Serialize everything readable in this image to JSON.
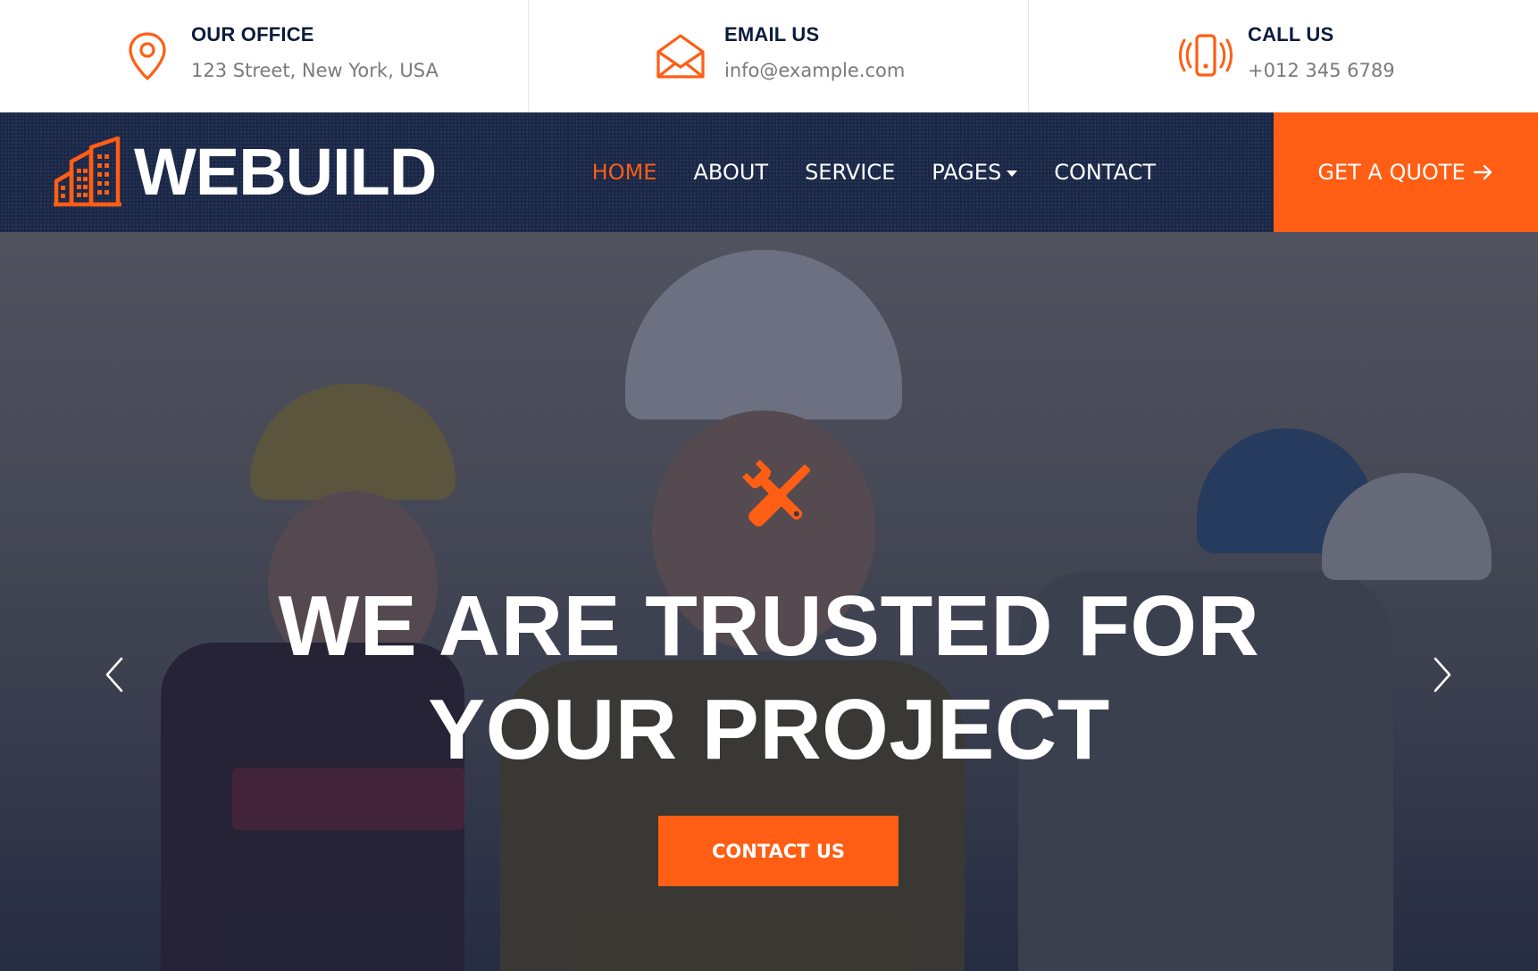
{
  "colors": {
    "accent": "#ff5e14",
    "navy": "#1a2747",
    "heading": "#0b1b3d",
    "muted": "#7a7a7a"
  },
  "topbar": {
    "office": {
      "icon": "map-pin-icon",
      "title": "OUR OFFICE",
      "value": "123 Street, New York, USA"
    },
    "email": {
      "icon": "envelope-icon",
      "title": "EMAIL US",
      "value": "info@example.com"
    },
    "phone": {
      "icon": "phone-vibrate-icon",
      "title": "CALL US",
      "value": "+012 345 6789"
    }
  },
  "navbar": {
    "brand": {
      "icon": "buildings-icon",
      "name": "WEBUILD"
    },
    "links": [
      {
        "label": "HOME",
        "active": true
      },
      {
        "label": "ABOUT",
        "active": false
      },
      {
        "label": "SERVICE",
        "active": false
      },
      {
        "label": "PAGES",
        "active": false,
        "dropdown": true
      },
      {
        "label": "CONTACT",
        "active": false
      }
    ],
    "quote_label": "GET A QUOTE",
    "quote_icon": "arrow-right-icon"
  },
  "hero": {
    "icon": "tools-icon",
    "title_line1": "WE ARE TRUSTED FOR",
    "title_line2": "YOUR PROJECT",
    "cta_label": "CONTACT US",
    "prev_icon": "chevron-left-icon",
    "next_icon": "chevron-right-icon"
  }
}
